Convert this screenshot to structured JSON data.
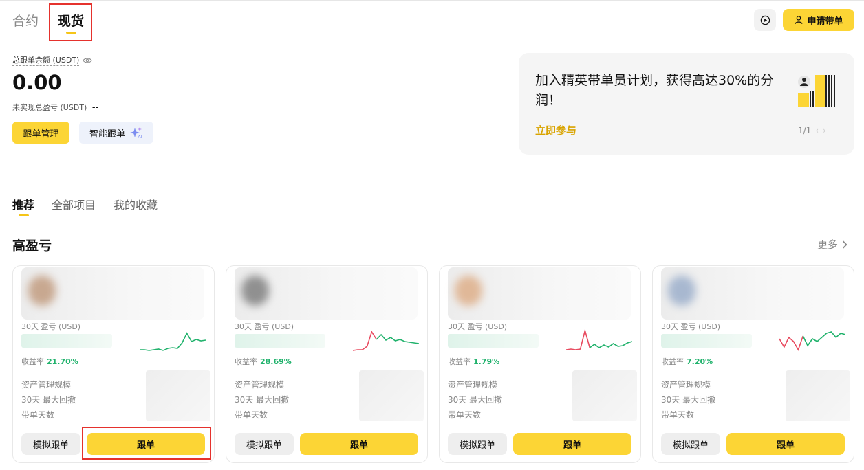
{
  "mode_tabs": [
    {
      "label": "合约",
      "active": false
    },
    {
      "label": "现货",
      "active": true
    }
  ],
  "header": {
    "apply_label": "申请带单"
  },
  "account": {
    "balance_label": "总跟单余额 (USDT)",
    "balance_value": "0.00",
    "pnl_label": "未实现总盈亏 (USDT)",
    "pnl_value": "--",
    "manage_label": "跟单管理",
    "smart_label": "智能跟单"
  },
  "banner": {
    "title": "加入精英带单员计划，获得高达30%的分润！",
    "link": "立即参与",
    "page": "1/1"
  },
  "sub_tabs": [
    {
      "label": "推荐",
      "active": true
    },
    {
      "label": "全部项目",
      "active": false
    },
    {
      "label": "我的收藏",
      "active": false
    }
  ],
  "section": {
    "title": "高盈亏",
    "more": "更多"
  },
  "card_labels": {
    "pnl": "30天 盈亏 (USD)",
    "roi": "收益率",
    "aum": "资产管理规模",
    "mdd": "30天 最大回撤",
    "days": "带单天数",
    "simulate": "模拟跟单",
    "follow": "跟单"
  },
  "cards": [
    {
      "roi": "21.70%",
      "spark": [
        30,
        30,
        31,
        30,
        29,
        31,
        28,
        27,
        28,
        20,
        6,
        18,
        15,
        17,
        16
      ]
    },
    {
      "roi": "28.69%",
      "spark": [
        31,
        30,
        30,
        25,
        4,
        15,
        8,
        16,
        12,
        17,
        15,
        18,
        19,
        20,
        21
      ]
    },
    {
      "roi": "1.79%",
      "spark": [
        30,
        29,
        30,
        29,
        2,
        27,
        22,
        27,
        23,
        26,
        21,
        25,
        24,
        20,
        18
      ]
    },
    {
      "roi": "7.20%",
      "spark": [
        14,
        26,
        12,
        18,
        30,
        10,
        24,
        14,
        18,
        12,
        6,
        4,
        12,
        6,
        8
      ]
    }
  ],
  "colors": {
    "accent": "#fcd535",
    "up": "#20b26c",
    "down": "#e84a5f",
    "highlight_box": "#e5322d"
  }
}
